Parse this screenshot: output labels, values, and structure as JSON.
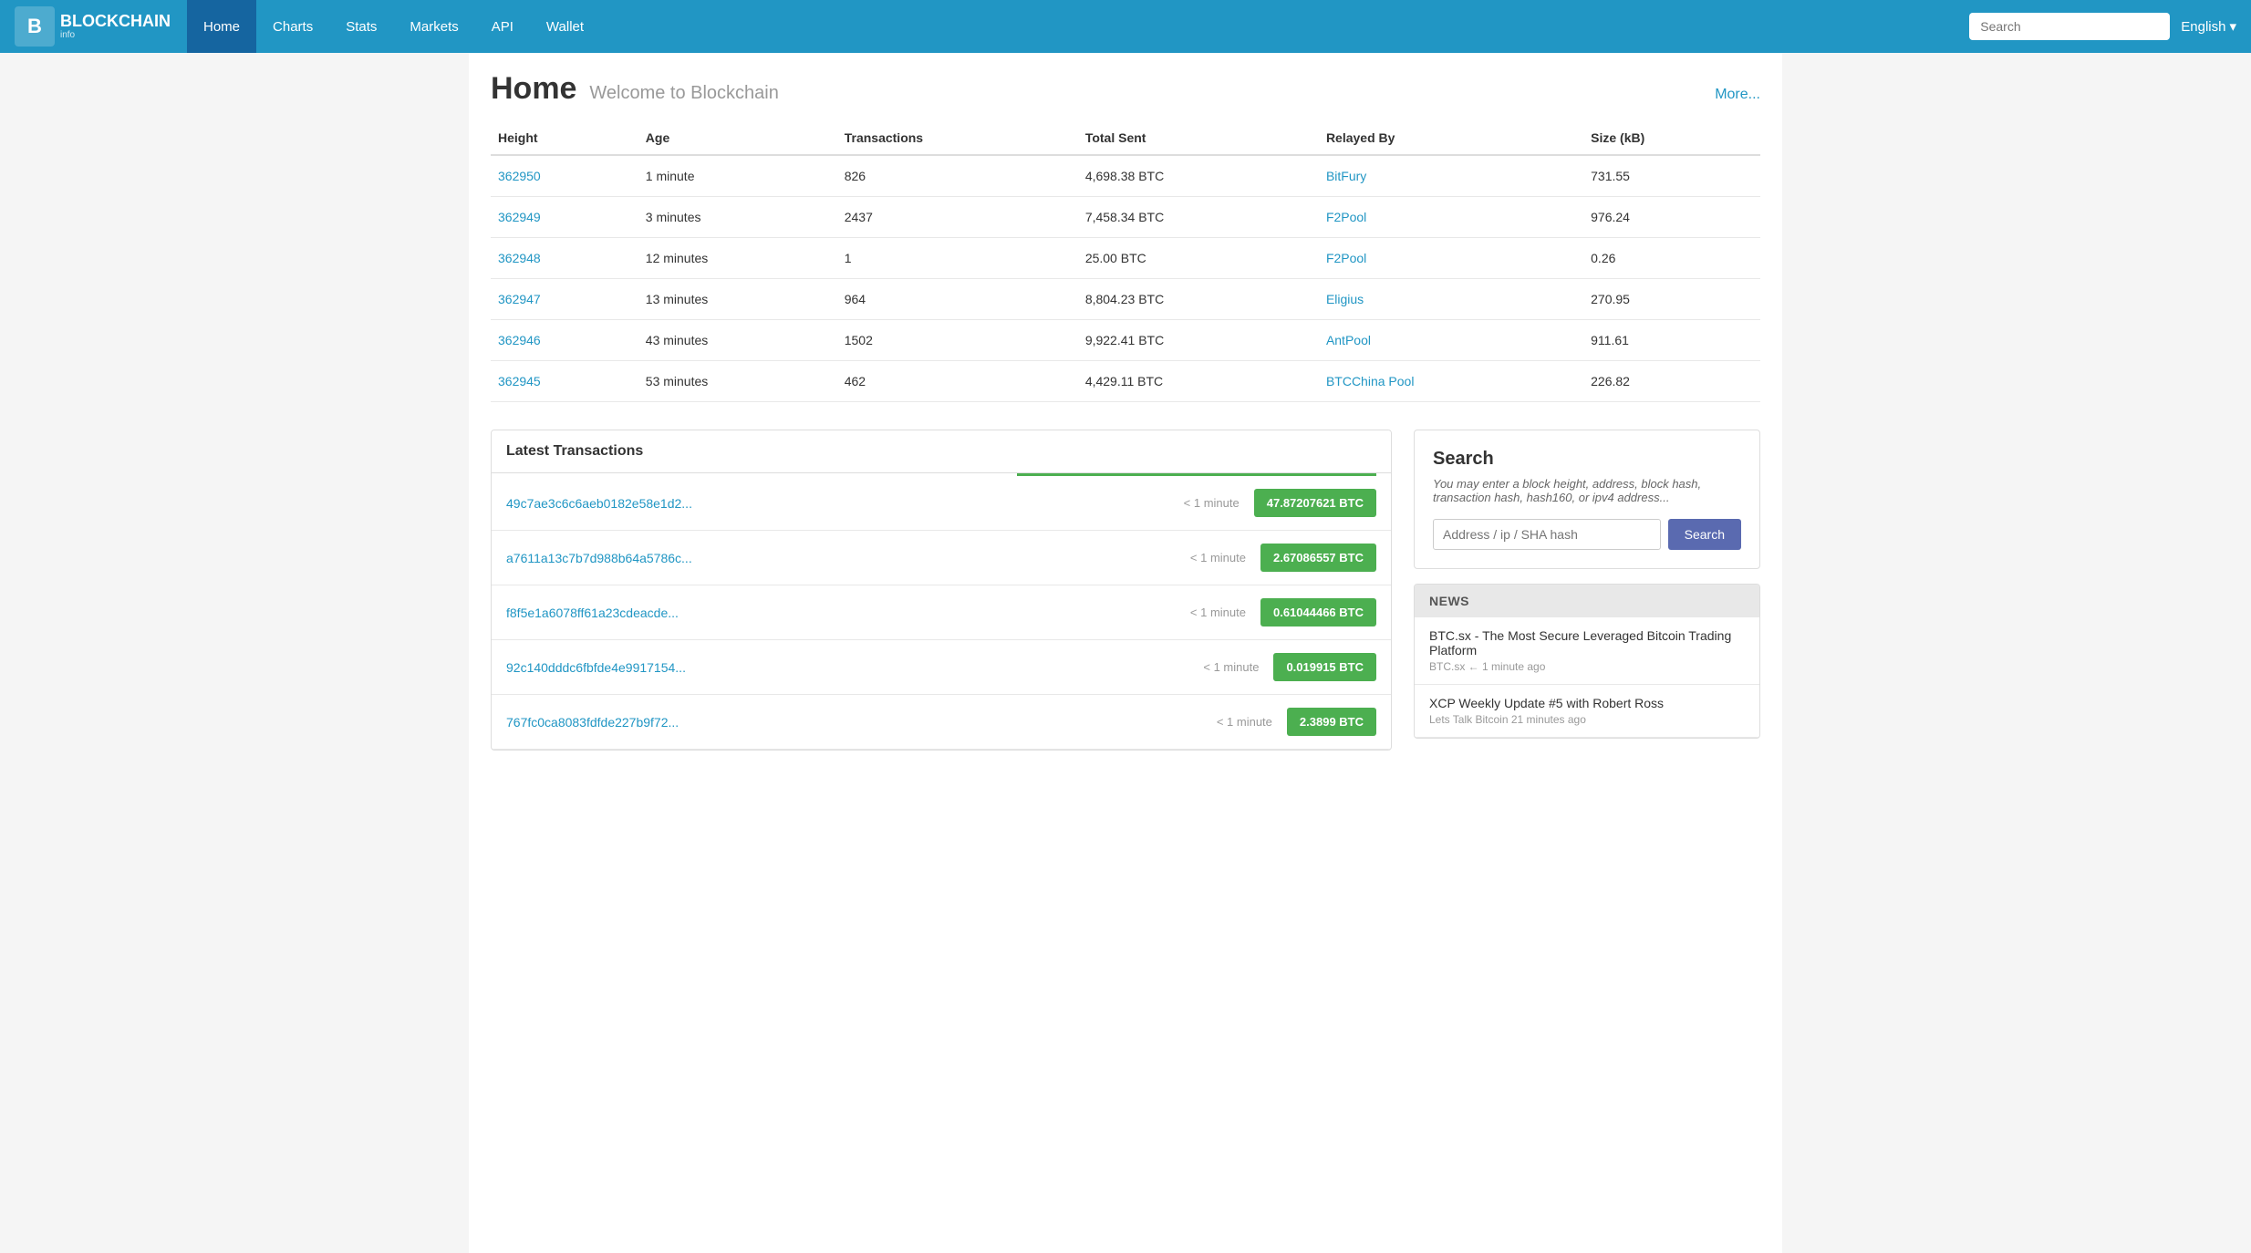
{
  "navbar": {
    "brand": "BLOCKCHAIN",
    "brand_sub": "info",
    "nav_items": [
      {
        "label": "Home",
        "active": true
      },
      {
        "label": "Charts",
        "active": false
      },
      {
        "label": "Stats",
        "active": false
      },
      {
        "label": "Markets",
        "active": false
      },
      {
        "label": "API",
        "active": false
      },
      {
        "label": "Wallet",
        "active": false
      }
    ],
    "search_placeholder": "Search",
    "language": "English"
  },
  "page": {
    "title": "Home",
    "subtitle": "Welcome to Blockchain",
    "more_label": "More..."
  },
  "blocks_table": {
    "headers": [
      "Height",
      "Age",
      "Transactions",
      "Total Sent",
      "Relayed By",
      "Size (kB)"
    ],
    "rows": [
      {
        "height": "362950",
        "age": "1 minute",
        "transactions": "826",
        "total_sent": "4,698.38 BTC",
        "relayed_by": "BitFury",
        "size": "731.55"
      },
      {
        "height": "362949",
        "age": "3 minutes",
        "transactions": "2437",
        "total_sent": "7,458.34 BTC",
        "relayed_by": "F2Pool",
        "size": "976.24"
      },
      {
        "height": "362948",
        "age": "12 minutes",
        "transactions": "1",
        "total_sent": "25.00 BTC",
        "relayed_by": "F2Pool",
        "size": "0.26"
      },
      {
        "height": "362947",
        "age": "13 minutes",
        "transactions": "964",
        "total_sent": "8,804.23 BTC",
        "relayed_by": "Eligius",
        "size": "270.95"
      },
      {
        "height": "362946",
        "age": "43 minutes",
        "transactions": "1502",
        "total_sent": "9,922.41 BTC",
        "relayed_by": "AntPool",
        "size": "911.61"
      },
      {
        "height": "362945",
        "age": "53 minutes",
        "transactions": "462",
        "total_sent": "4,429.11 BTC",
        "relayed_by": "BTCChina Pool",
        "size": "226.82"
      }
    ]
  },
  "latest_transactions": {
    "title": "Latest Transactions",
    "rows": [
      {
        "hash": "49c7ae3c6c6aeb0182e58e1d2...",
        "time": "< 1 minute",
        "amount": "47.87207621 BTC"
      },
      {
        "hash": "a7611a13c7b7d988b64a5786c...",
        "time": "< 1 minute",
        "amount": "2.67086557 BTC"
      },
      {
        "hash": "f8f5e1a6078ff61a23cdeacde...",
        "time": "< 1 minute",
        "amount": "0.61044466 BTC"
      },
      {
        "hash": "92c140dddc6fbfde4e9917154...",
        "time": "< 1 minute",
        "amount": "0.019915 BTC"
      },
      {
        "hash": "767fc0ca8083fdfde227b9f72...",
        "time": "< 1 minute",
        "amount": "2.3899 BTC"
      }
    ]
  },
  "search_panel": {
    "title": "Search",
    "description": "You may enter a block height, address, block hash, transaction hash, hash160, or ipv4 address...",
    "input_placeholder": "Address / ip / SHA hash",
    "button_label": "Search"
  },
  "news_panel": {
    "header": "NEWS",
    "items": [
      {
        "title": "BTC.sx - The Most Secure Leveraged Bitcoin Trading Platform",
        "meta": "BTC.sx ← 1 minute ago"
      },
      {
        "title": "XCP Weekly Update #5 with Robert Ross",
        "meta": "Lets Talk Bitcoin 21 minutes ago"
      }
    ]
  }
}
